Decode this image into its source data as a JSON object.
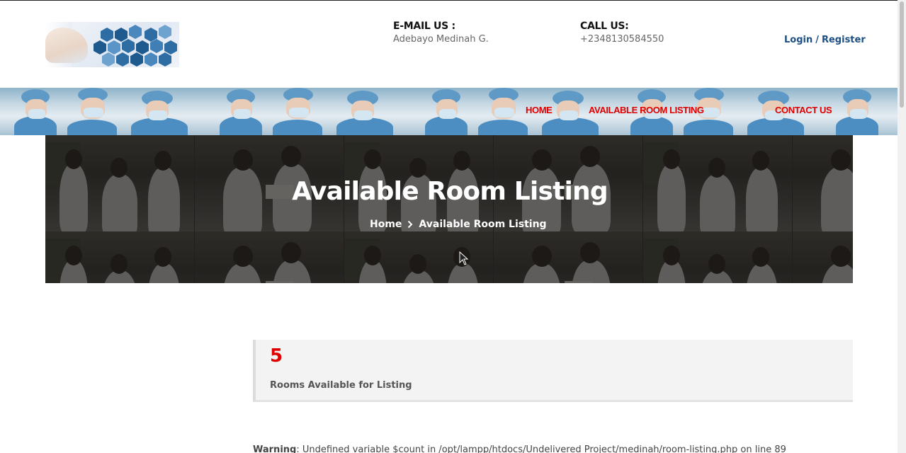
{
  "header": {
    "logo_name": "medical-hexagon-logo",
    "email": {
      "title": "E-MAIL US :",
      "value": "Adebayo Medinah G."
    },
    "call": {
      "title": "CALL US:",
      "value": "+2348130584550"
    },
    "auth": {
      "login": "Login",
      "separator": "/",
      "register": "Register"
    }
  },
  "nav": {
    "items": [
      {
        "label": "HOME"
      },
      {
        "label": "AVAILABLE ROOM LISTING"
      },
      {
        "label": "CONTACT US"
      }
    ],
    "color": "#e00000"
  },
  "hero": {
    "title": "Available Room Listing",
    "breadcrumb": {
      "home": "Home",
      "current": "Available Room Listing"
    }
  },
  "stats": {
    "count": "5",
    "label": "Rooms Available for Listing",
    "count_color": "#e00000"
  },
  "warning": {
    "prefix": "Warning",
    "message": ": Undefined variable $count in /opt/lampp/htdocs/Undelivered Project/medinah/room-listing.php on line 89"
  },
  "colors": {
    "link": "#1c4f83",
    "accent": "#e00000"
  }
}
